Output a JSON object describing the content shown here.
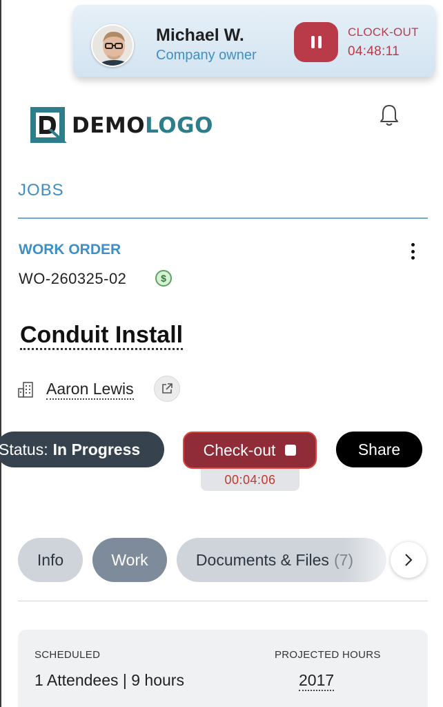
{
  "clock_card": {
    "user_name": "Michael W.",
    "user_role": "Company owner",
    "clock_label": "CLOCK-OUT",
    "clock_time": "04:48:11",
    "accent_color": "#b93a48"
  },
  "header": {
    "logo_word_1": "DEMO",
    "logo_word_2": "LOGO",
    "logo_color": "#2e7d8a",
    "notification_icon": "bell-icon"
  },
  "section": {
    "title": "JOBS"
  },
  "work_order": {
    "label": "WORK ORDER",
    "number": "WO-260325-02",
    "badge_symbol": "$",
    "job_title": "Conduit Install",
    "client_name": "Aaron Lewis"
  },
  "actions": {
    "status_prefix": "Status:",
    "status_value": "In Progress",
    "checkout_label": "Check-out",
    "checkout_timer": "00:04:06",
    "share_label": "Share"
  },
  "tabs": [
    {
      "label": "Info",
      "selected": false
    },
    {
      "label": "Work",
      "selected": true
    },
    {
      "label": "Documents & Files",
      "count": "(7)",
      "selected": false
    }
  ],
  "summary": {
    "scheduled_label": "SCHEDULED",
    "scheduled_value": "1 Attendees | 9 hours",
    "projected_label": "PROJECTED HOURS",
    "projected_value": "2017"
  }
}
